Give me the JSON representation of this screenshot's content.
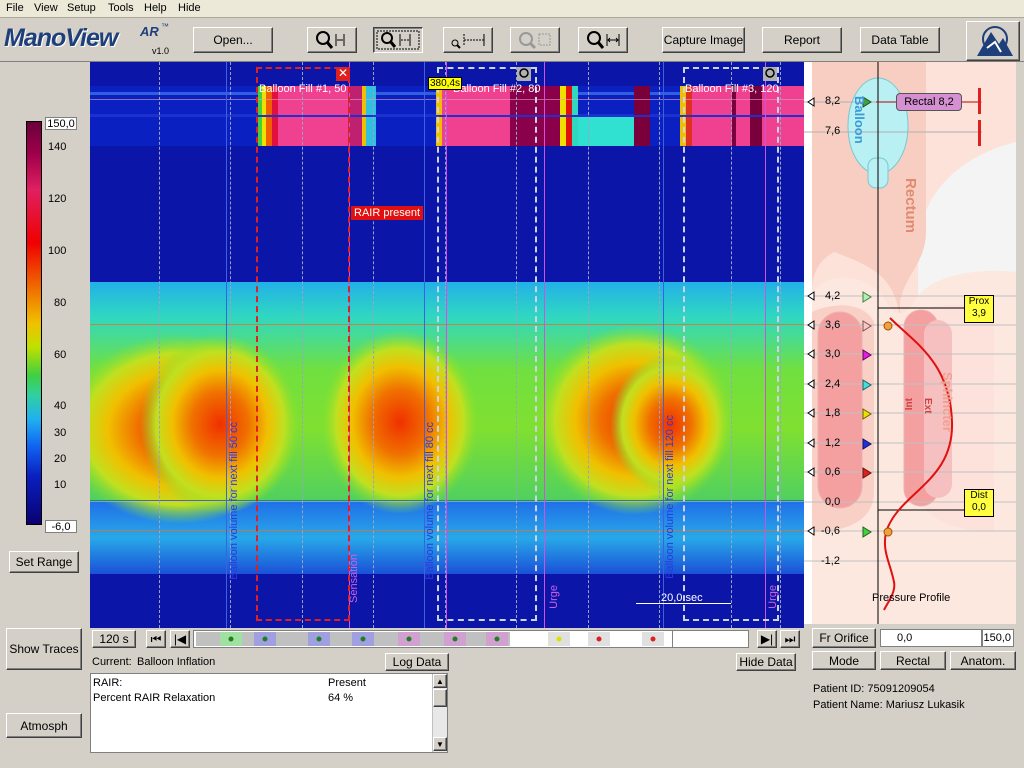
{
  "menu": {
    "file": "File",
    "view": "View",
    "setup": "Setup",
    "tools": "Tools",
    "help": "Help",
    "hide": "Hide"
  },
  "logo": {
    "name": "ManoView",
    "suffix": "AR",
    "tm": "™",
    "version": "v1.0"
  },
  "toolbar": {
    "open": "Open...",
    "capture": "Capture Image",
    "report": "Report",
    "data_table": "Data Table"
  },
  "scale": {
    "max": "150,0",
    "min": "-6,0",
    "ticks": [
      "140",
      "120",
      "100",
      "80",
      "60",
      "40",
      "30",
      "20",
      "10"
    ],
    "set_range": "Set Range"
  },
  "buttons": {
    "show_traces": "Show Traces",
    "atmosph": "Atmosph"
  },
  "plot": {
    "cursor_time": "380,4s",
    "fill_labels": [
      "Balloon Fill #1, 50",
      "Balloon Fill #2, 80",
      "Balloon Fill #3, 120"
    ],
    "rair_label": "RAIR present",
    "scale_bar": "20,0 sec",
    "vertical_labels": [
      "Balloon volume for next fill 50 cc",
      "Sensation",
      "Balloon volume for next fill 80 cc",
      "Urge",
      "Balloon volume for next fill 120 cc",
      "Urge"
    ]
  },
  "anatomy": {
    "positions": [
      "8,2",
      "7,6",
      "4,2",
      "3,6",
      "3,0",
      "2,4",
      "1,8",
      "1,2",
      "0,6",
      "0,0",
      "-0,6",
      "-1,2"
    ],
    "balloon": "Balloon",
    "rectum": "Rectum",
    "sphincter": "Sphincter",
    "int": "Int",
    "ext": "Ext",
    "rectal_tag": "Rectal 8,2",
    "prox_tag": "Prox",
    "prox_value": "3,9",
    "dist_tag": "Dist",
    "dist_value": "0,0",
    "profile_label": "Pressure Profile"
  },
  "timeline": {
    "window": "120 s"
  },
  "current": {
    "label": "Current:",
    "value": "Balloon Inflation",
    "log_data": "Log Data",
    "hide_data": "Hide Data"
  },
  "results": {
    "rows": [
      {
        "name": "RAIR:",
        "value": "Present"
      },
      {
        "name": "Percent RAIR Relaxation",
        "value": "64 %"
      }
    ]
  },
  "right_controls": {
    "fr_orifice": "Fr Orifice",
    "range_min": "0,0",
    "range_max": "150,0",
    "mode": "Mode",
    "rectal": "Rectal",
    "anatom": "Anatom."
  },
  "patient": {
    "id_label": "Patient ID:",
    "id": "75091209054",
    "name_label": "Patient Name:",
    "name": "Mariusz Lukasik"
  },
  "colors": {
    "low": "#0b16a8",
    "mid": "#22c8e0",
    "green": "#40d040",
    "yellow": "#f0e000",
    "orange": "#f07000",
    "red": "#e02020",
    "pink": "#f04090",
    "high": "#7a003c"
  }
}
